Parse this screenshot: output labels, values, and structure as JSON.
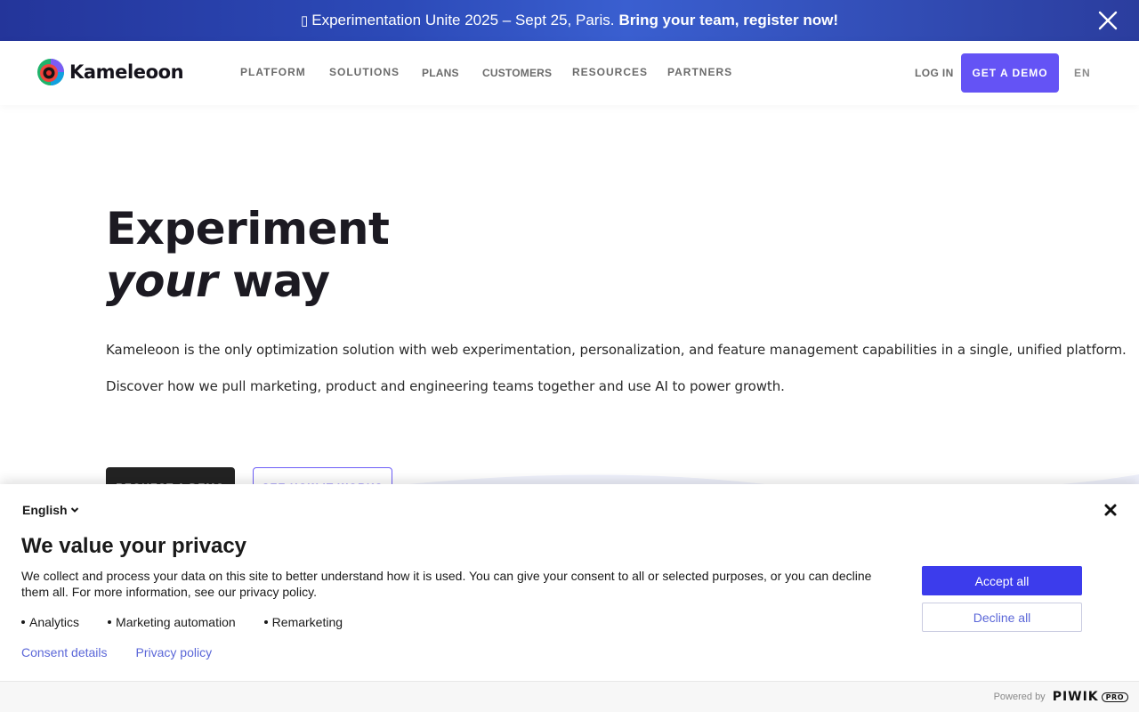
{
  "banner": {
    "glyph": "▯",
    "lead": "Experimentation Unite 2025 – Sept 25, Paris.",
    "cta": "Bring your team, register now!",
    "close_icon": "close-icon"
  },
  "header": {
    "logo_text": "Kameleoon",
    "nav": [
      "PLATFORM",
      "SOLUTIONS",
      "PLANS",
      "CUSTOMERS",
      "RESOURCES",
      "PARTNERS"
    ],
    "login": "LOG IN",
    "demo_button": "GET A DEMO",
    "language": "EN"
  },
  "hero": {
    "title_line1": "Experiment",
    "title_em": "your",
    "title_rest": " way",
    "paragraph1": "Kameleoon is the only optimization solution with web experimentation, personalization, and feature management capabilities in a single, unified platform.",
    "paragraph2": "Discover how we pull marketing, product and engineering teams together and use AI to power growth.",
    "primary_button": "REQUEST A DEMO",
    "secondary_button": "SEE HOW IT WORKS"
  },
  "consent": {
    "language": "English",
    "title": "We value your privacy",
    "text": "We collect and process your data on this site to better understand how it is used. You can give your consent to all or selected purposes, or you can decline them all. For more information, see our privacy policy.",
    "purposes": [
      "Analytics",
      "Marketing automation",
      "Remarketing"
    ],
    "links": [
      "Consent details",
      "Privacy policy"
    ],
    "accept": "Accept all",
    "decline": "Decline all",
    "powered_by": "Powered by",
    "brand": "PIWIK",
    "brand_badge": "PRO"
  },
  "colors": {
    "accent": "#6453f5",
    "consent_accept": "#3c3cec",
    "link": "#5b67d8"
  }
}
